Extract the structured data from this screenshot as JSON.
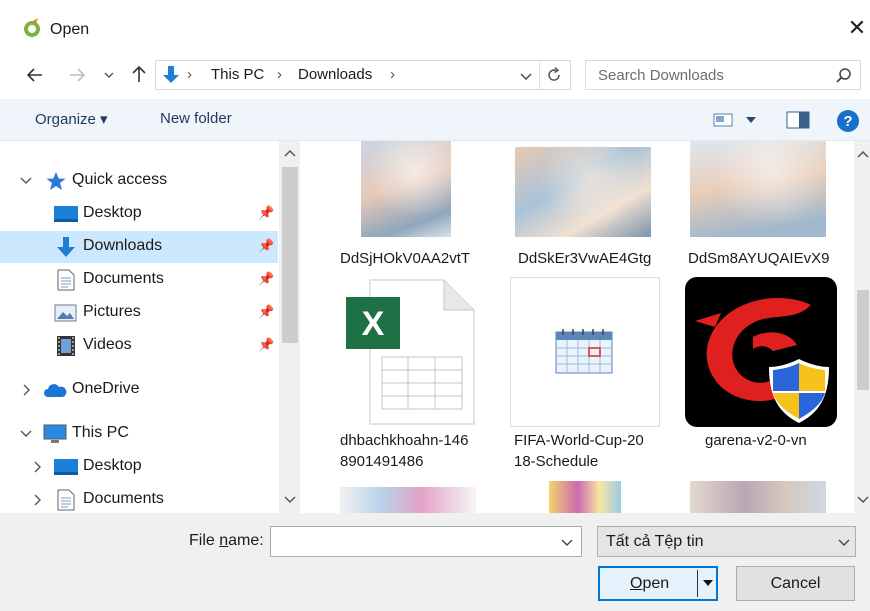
{
  "window": {
    "title": "Open",
    "close_glyph": "✕"
  },
  "address": {
    "breadcrumb": [
      "This PC",
      "Downloads"
    ],
    "separator": "›",
    "search_placeholder": "Search Downloads"
  },
  "toolbar": {
    "organize": "Organize",
    "new_folder": "New folder"
  },
  "nav": {
    "quick_access": "Quick access",
    "quick_items": [
      "Desktop",
      "Downloads",
      "Documents",
      "Pictures",
      "Videos"
    ],
    "onedrive": "OneDrive",
    "this_pc": "This PC",
    "pc_items": [
      "Desktop",
      "Documents"
    ]
  },
  "files": [
    {
      "name": "DdSjHOkV0AA2vtT",
      "kind": "photo"
    },
    {
      "name": "DdSkEr3VwAE4Gtg",
      "kind": "photo"
    },
    {
      "name": "DdSm8AYUQAIEvX9",
      "kind": "photo"
    },
    {
      "name_line1": "dhbachkhoahn-146",
      "name_line2": "8901491486",
      "kind": "excel"
    },
    {
      "name_line1": "FIFA-World-Cup-20",
      "name_line2": "18-Schedule",
      "kind": "calendar"
    },
    {
      "name": "garena-v2-0-vn",
      "kind": "exe"
    }
  ],
  "footer": {
    "file_name_prefix": "File ",
    "file_name_underlined": "n",
    "file_name_suffix": "ame:",
    "file_name_value": "",
    "filter": "Tất cả Tệp tin",
    "open_underlined": "O",
    "open_rest": "pen",
    "cancel": "Cancel"
  },
  "colors": {
    "accent": "#0078d7",
    "selection": "#cce8ff",
    "command_bar": "#f0f5fb",
    "help": "#1a6fc9"
  }
}
